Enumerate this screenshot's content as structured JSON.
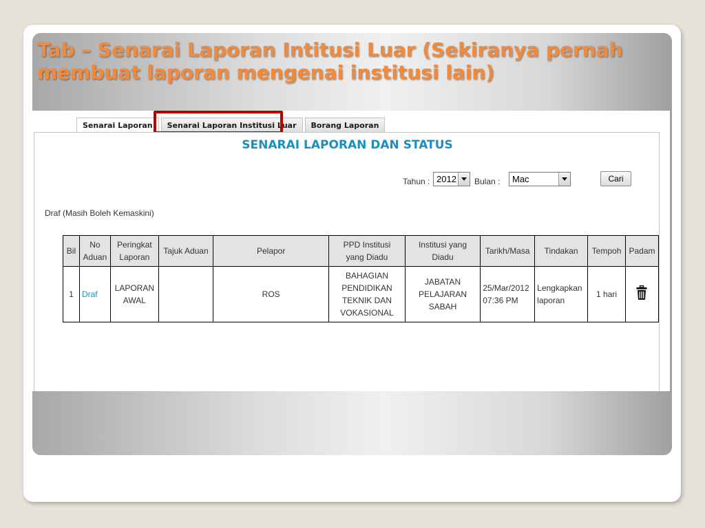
{
  "slide": {
    "title": "Tab – Senarai Laporan Intitusi Luar (Sekiranya pernah membuat laporan mengenai institusi lain)"
  },
  "tabs": [
    {
      "label": "Senarai Laporan"
    },
    {
      "label": "Senarai Laporan Institusi Luar"
    },
    {
      "label": "Borang Laporan"
    }
  ],
  "panel": {
    "heading": "SENARAI LAPORAN DAN STATUS"
  },
  "filters": {
    "tahun_label": "Tahun :",
    "tahun_value": "2012",
    "bulan_label": "Bulan :",
    "bulan_value": "Mac",
    "search_label": "Cari"
  },
  "section": {
    "draft_label": "Draf (Masih Boleh Kemaskini)"
  },
  "table": {
    "headers": {
      "bil": "Bil",
      "no_aduan_1": "No",
      "no_aduan_2": "Aduan",
      "peringkat_1": "Peringkat",
      "peringkat_2": "Laporan",
      "tajuk": "Tajuk Aduan",
      "pelapor": "Pelapor",
      "ppd_1": "PPD Institusi",
      "ppd_2": "yang Diadu",
      "institusi_1": "Institusi yang",
      "institusi_2": "Diadu",
      "tarikh": "Tarikh/Masa",
      "tindakan": "Tindakan",
      "tempoh": "Tempoh",
      "padam": "Padam"
    },
    "rows": [
      {
        "bil": "1",
        "no_aduan": "Draf",
        "peringkat_1": "LAPORAN",
        "peringkat_2": "AWAL",
        "tajuk": "",
        "pelapor": "ROS",
        "ppd_1": "BAHAGIAN",
        "ppd_2": "PENDIDIKAN",
        "ppd_3": "TEKNIK DAN",
        "ppd_4": "VOKASIONAL",
        "institusi_1": "JABATAN",
        "institusi_2": "PELAJARAN",
        "institusi_3": "SABAH",
        "tarikh_1": "25/Mar/2012",
        "tarikh_2": "07:36 PM",
        "tindakan_1": "Lengkapkan",
        "tindakan_2": "laporan",
        "tempoh": "1 hari",
        "padam_icon": "trash-icon"
      }
    ]
  },
  "colors": {
    "title": "#f08a3c",
    "heading": "#1a8fc4",
    "link": "#1a8fc4",
    "highlight": "#b40000"
  }
}
